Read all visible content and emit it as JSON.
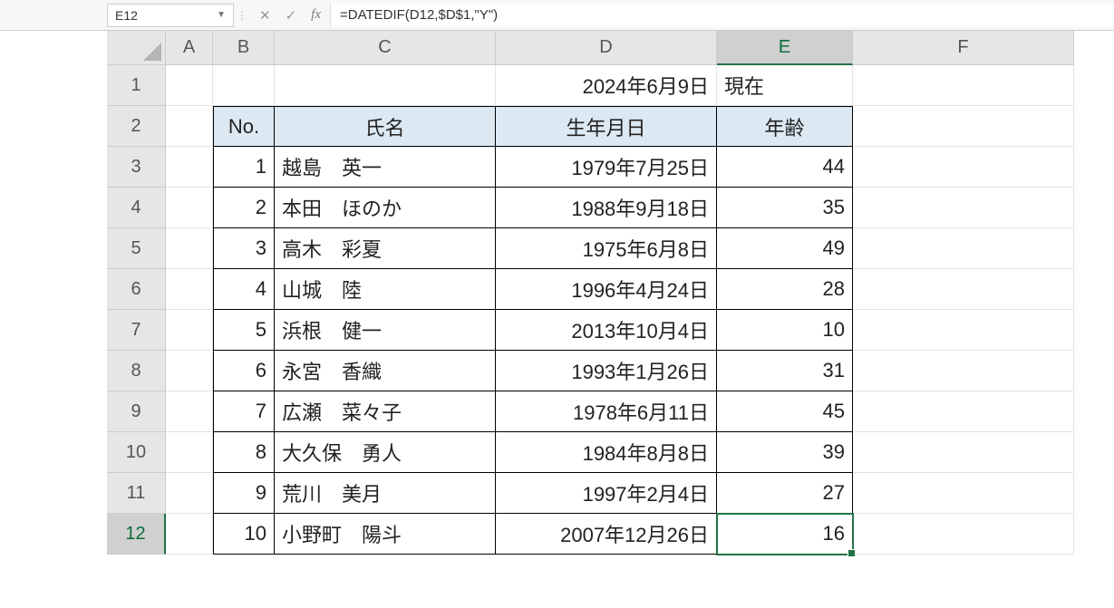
{
  "formula_bar": {
    "cell_ref": "E12",
    "formula": "=DATEDIF(D12,$D$1,\"Y\")"
  },
  "columns": [
    "A",
    "B",
    "C",
    "D",
    "E",
    "F"
  ],
  "rows": [
    "1",
    "2",
    "3",
    "4",
    "5",
    "6",
    "7",
    "8",
    "9",
    "10",
    "11",
    "12"
  ],
  "active_col": "E",
  "active_row": "12",
  "reference_date": "2024年6月9日",
  "reference_label": "現在",
  "table": {
    "headers": {
      "no": "No.",
      "name": "氏名",
      "dob": "生年月日",
      "age": "年齢"
    },
    "rows": [
      {
        "no": "1",
        "name": "越島　英一",
        "dob": "1979年7月25日",
        "age": "44"
      },
      {
        "no": "2",
        "name": "本田　ほのか",
        "dob": "1988年9月18日",
        "age": "35"
      },
      {
        "no": "3",
        "name": "高木　彩夏",
        "dob": "1975年6月8日",
        "age": "49"
      },
      {
        "no": "4",
        "name": "山城　陸",
        "dob": "1996年4月24日",
        "age": "28"
      },
      {
        "no": "5",
        "name": "浜根　健一",
        "dob": "2013年10月4日",
        "age": "10"
      },
      {
        "no": "6",
        "name": "永宮　香織",
        "dob": "1993年1月26日",
        "age": "31"
      },
      {
        "no": "7",
        "name": "広瀬　菜々子",
        "dob": "1978年6月11日",
        "age": "45"
      },
      {
        "no": "8",
        "name": "大久保　勇人",
        "dob": "1984年8月8日",
        "age": "39"
      },
      {
        "no": "9",
        "name": "荒川　美月",
        "dob": "1997年2月4日",
        "age": "27"
      },
      {
        "no": "10",
        "name": "小野町　陽斗",
        "dob": "2007年12月26日",
        "age": "16"
      }
    ]
  }
}
